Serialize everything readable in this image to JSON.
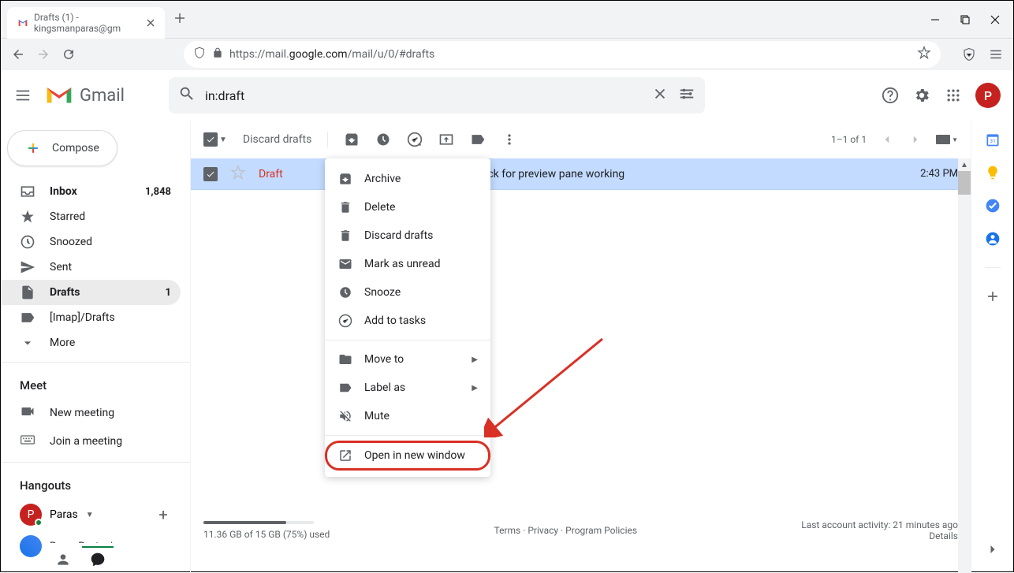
{
  "browser": {
    "tab_title": "Drafts (1) - kingsmanparas@gm",
    "url_prefix": "https://mail.",
    "url_domain": "google.com",
    "url_path": "/mail/u/0/#drafts"
  },
  "header": {
    "logo_text": "Gmail",
    "search_value": "in:draft",
    "avatar_letter": "P"
  },
  "compose_label": "Compose",
  "nav": {
    "inbox": {
      "label": "Inbox",
      "count": "1,848"
    },
    "starred": {
      "label": "Starred"
    },
    "snoozed": {
      "label": "Snoozed"
    },
    "sent": {
      "label": "Sent"
    },
    "drafts": {
      "label": "Drafts",
      "count": "1"
    },
    "imap_drafts": {
      "label": "[Imap]/Drafts"
    },
    "more": {
      "label": "More"
    }
  },
  "meet": {
    "title": "Meet",
    "new": "New meeting",
    "join": "Join a meeting"
  },
  "hangouts": {
    "title": "Hangouts",
    "user": "Paras",
    "contact": "Paras Rastogi"
  },
  "toolbar": {
    "discard": "Discard drafts",
    "count": "1–1 of 1"
  },
  "email": {
    "sender": "Draft",
    "body": "a test email to check for preview pane working",
    "time": "2:43 PM"
  },
  "context": {
    "archive": "Archive",
    "delete": "Delete",
    "discard": "Discard drafts",
    "unread": "Mark as unread",
    "snooze": "Snooze",
    "tasks": "Add to tasks",
    "moveto": "Move to",
    "labelas": "Label as",
    "mute": "Mute",
    "openwin": "Open in new window"
  },
  "footer": {
    "storage": "11.36 GB of 15 GB (75%) used",
    "terms": "Terms",
    "privacy": "Privacy",
    "policies": "Program Policies",
    "activity": "Last account activity: 21 minutes ago",
    "details": "Details"
  }
}
